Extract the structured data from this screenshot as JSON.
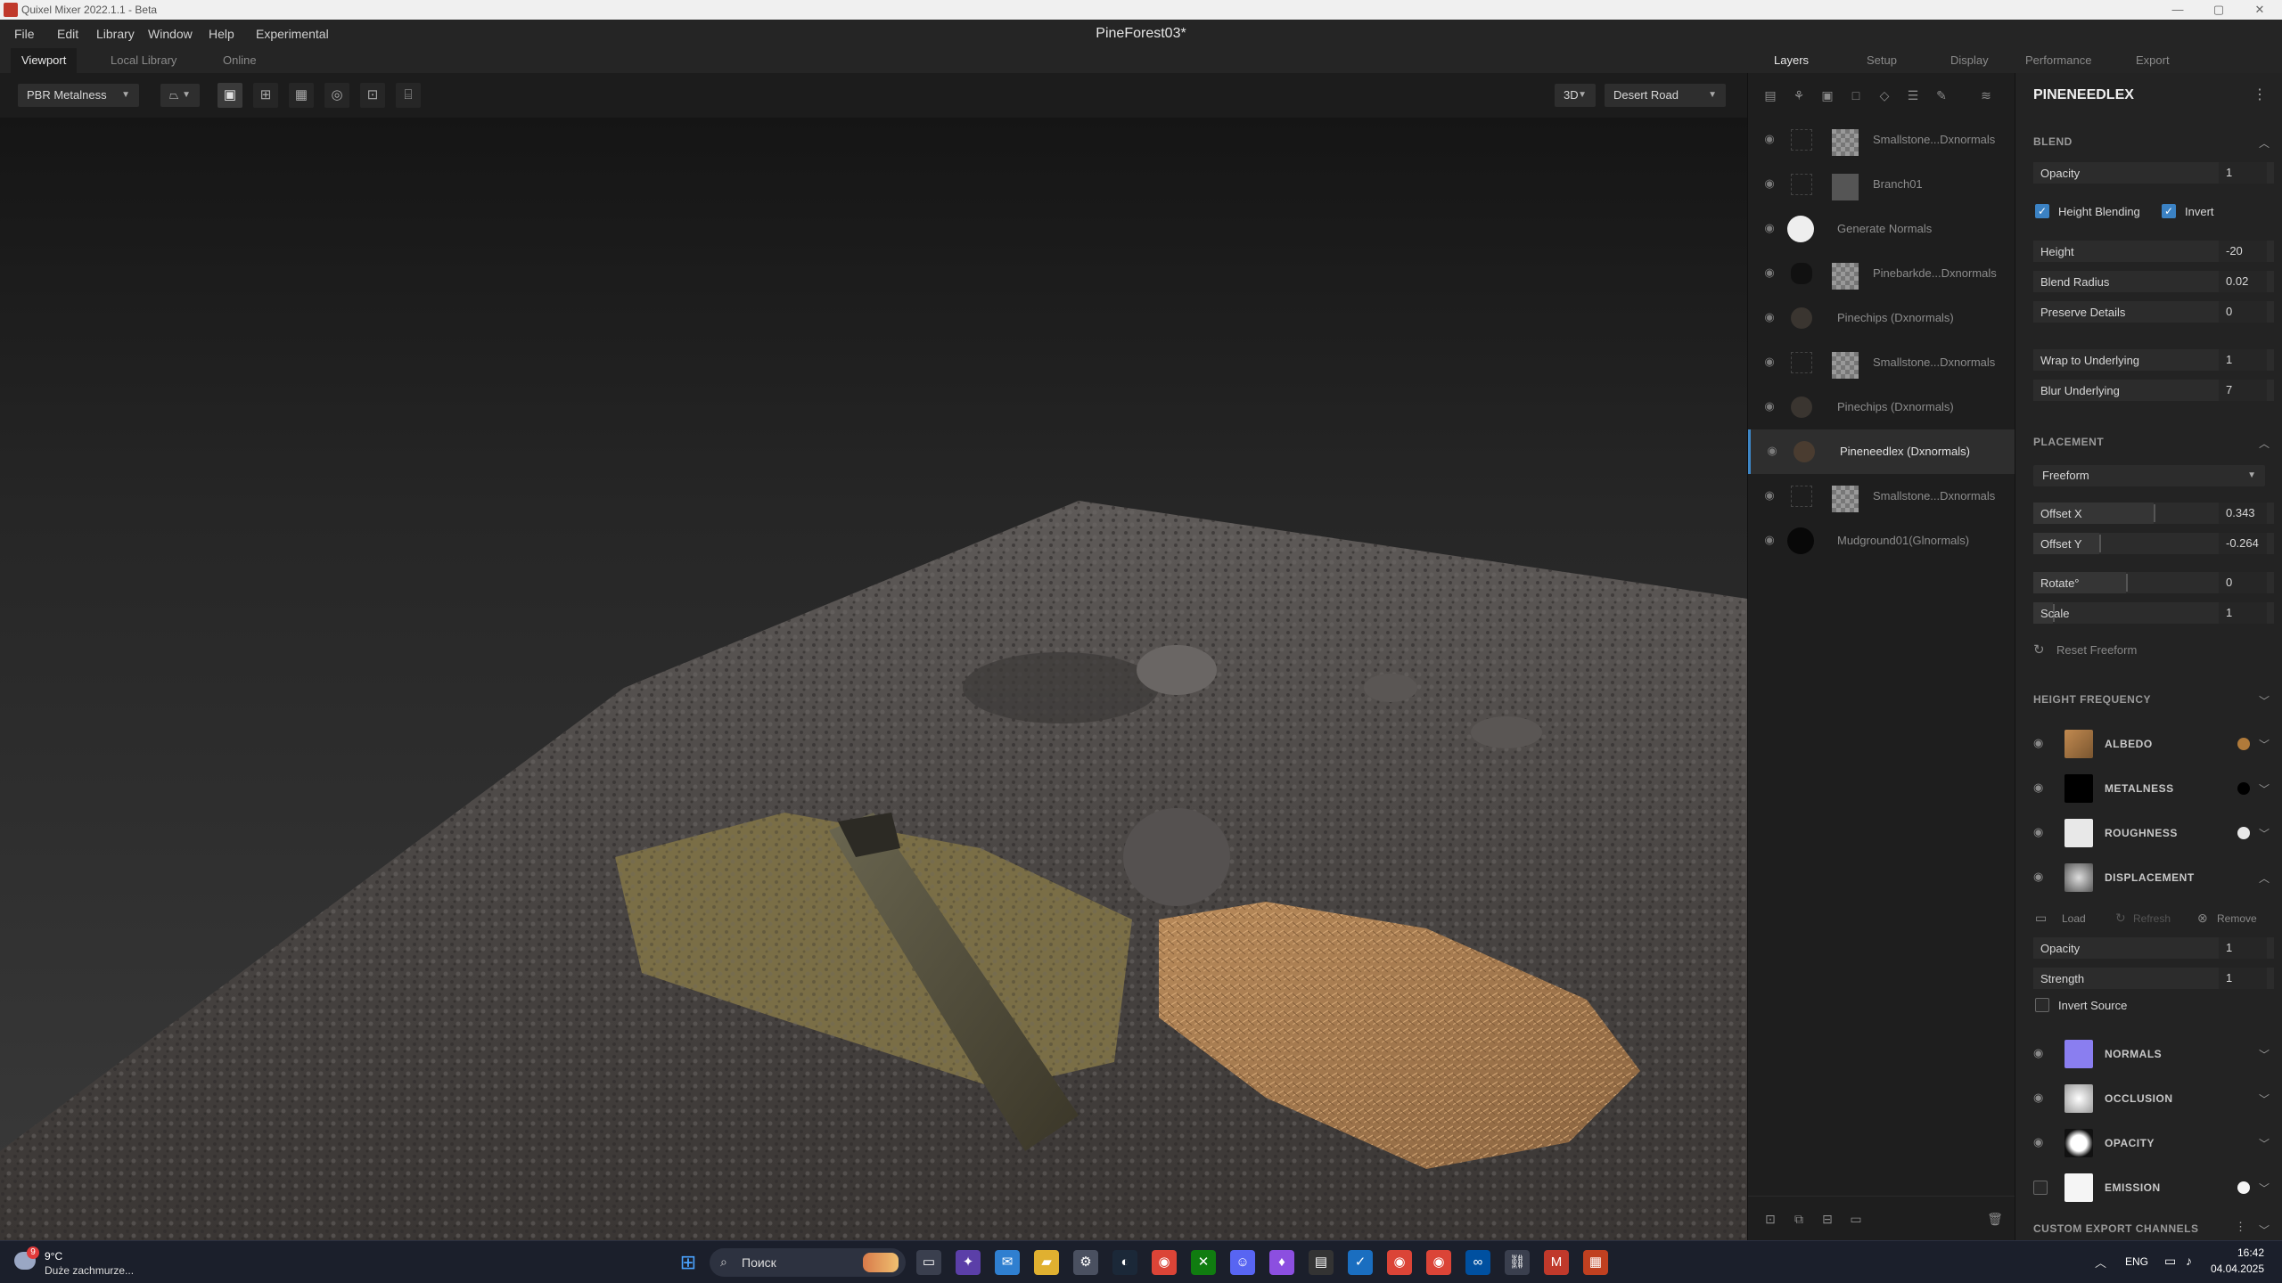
{
  "titlebar": {
    "title": "Quixel Mixer 2022.1.1 - Beta",
    "minimize": "—",
    "maximize": "▢",
    "close": "✕"
  },
  "menu": {
    "items": [
      "File",
      "Edit",
      "Library",
      "Window",
      "Help",
      "Experimental"
    ],
    "doc_title": "PineForest03*"
  },
  "left_tabs": [
    "Viewport",
    "Local Library",
    "Online"
  ],
  "right_tabs": [
    "Layers",
    "Setup",
    "Display",
    "Performance",
    "Export"
  ],
  "viewport_toolbar": {
    "material_mode": "PBR Metalness",
    "view_mode": "3D",
    "environment": "Desert Road"
  },
  "layers": [
    {
      "name": "Smallstone...Dxnormals",
      "thumb": "checker"
    },
    {
      "name": "Branch01",
      "thumb": "branch"
    },
    {
      "name": "Generate Normals",
      "thumb": "white-circle"
    },
    {
      "name": "Pinebarkde...Dxnormals",
      "thumb": "checker"
    },
    {
      "name": "Pinechips (Dxnormals)",
      "thumb": "none"
    },
    {
      "name": "Smallstone...Dxnormals",
      "thumb": "checker"
    },
    {
      "name": "Pinechips (Dxnormals)",
      "thumb": "none"
    },
    {
      "name": "Pineneedlex (Dxnormals)",
      "thumb": "none",
      "active": true
    },
    {
      "name": "Smallstone...Dxnormals",
      "thumb": "checker"
    },
    {
      "name": "Mudground01(Glnormals)",
      "thumb": "black-circle"
    }
  ],
  "props": {
    "layer_name": "PINENEEDLEX",
    "blend": {
      "title": "BLEND",
      "opacity_label": "Opacity",
      "opacity": "1",
      "height_blending": "Height Blending",
      "invert": "Invert",
      "height_label": "Height",
      "height": "-20",
      "blend_radius_label": "Blend Radius",
      "blend_radius": "0.02",
      "preserve_label": "Preserve Details",
      "preserve": "0",
      "wrap_label": "Wrap to Underlying",
      "wrap": "1",
      "blur_label": "Blur Underlying",
      "blur": "7"
    },
    "placement": {
      "title": "PLACEMENT",
      "mode": "Freeform",
      "offset_x_label": "Offset X",
      "offset_x": "0.343",
      "offset_y_label": "Offset Y",
      "offset_y": "-0.264",
      "rotate_label": "Rotate°",
      "rotate": "0",
      "scale_label": "Scale",
      "scale": "1",
      "reset": "Reset Freeform"
    },
    "height_frequency": "HEIGHT FREQUENCY",
    "maps": {
      "albedo": "ALBEDO",
      "metalness": "METALNESS",
      "roughness": "ROUGHNESS",
      "displacement": "DISPLACEMENT",
      "normals": "NORMALS",
      "occlusion": "OCCLUSION",
      "opacity": "OPACITY",
      "emission": "EMISSION"
    },
    "displacement": {
      "load": "Load",
      "refresh": "Refresh",
      "remove": "Remove",
      "opacity_label": "Opacity",
      "opacity": "1",
      "strength_label": "Strength",
      "strength": "1",
      "invert_source": "Invert Source"
    },
    "custom_export": "CUSTOM EXPORT CHANNELS",
    "colors": {
      "albedo_dot": "#b07a3a",
      "metalness_dot": "#000000",
      "roughness_dot": "#e8e8e8",
      "emission_dot": "#f5f5f5"
    }
  },
  "taskbar": {
    "weather_temp": "9°C",
    "weather_desc": "Duże zachmurze...",
    "search_placeholder": "Поиск",
    "lang": "ENG",
    "time": "16:42",
    "date": "04.04.2025",
    "badge": "9"
  }
}
